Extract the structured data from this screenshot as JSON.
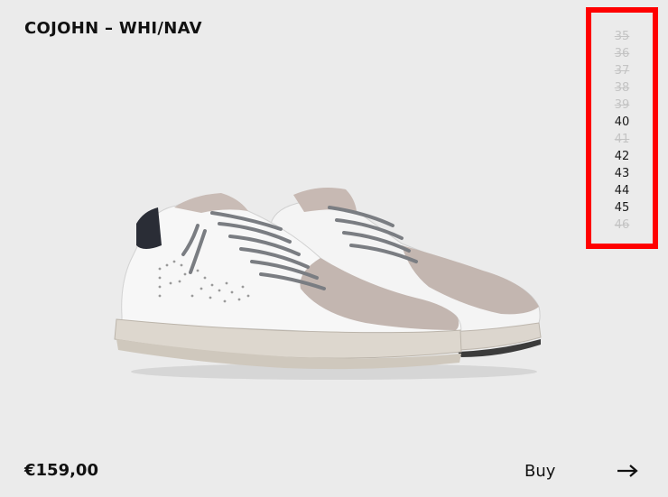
{
  "product": {
    "title": "COJOHN – WHI/NAV",
    "price": "€159,00"
  },
  "sizes": [
    {
      "label": "35",
      "available": false
    },
    {
      "label": "36",
      "available": false
    },
    {
      "label": "37",
      "available": false
    },
    {
      "label": "38",
      "available": false
    },
    {
      "label": "39",
      "available": false
    },
    {
      "label": "40",
      "available": true
    },
    {
      "label": "41",
      "available": false
    },
    {
      "label": "42",
      "available": true
    },
    {
      "label": "43",
      "available": true
    },
    {
      "label": "44",
      "available": true
    },
    {
      "label": "45",
      "available": true
    },
    {
      "label": "46",
      "available": false
    }
  ],
  "actions": {
    "buy_label": "Buy",
    "buy_icon": "arrow-right-icon"
  },
  "colors": {
    "background": "#ebebeb",
    "highlight_border": "#ff0000",
    "unavailable_size": "#c4c4c4",
    "text": "#111111"
  }
}
